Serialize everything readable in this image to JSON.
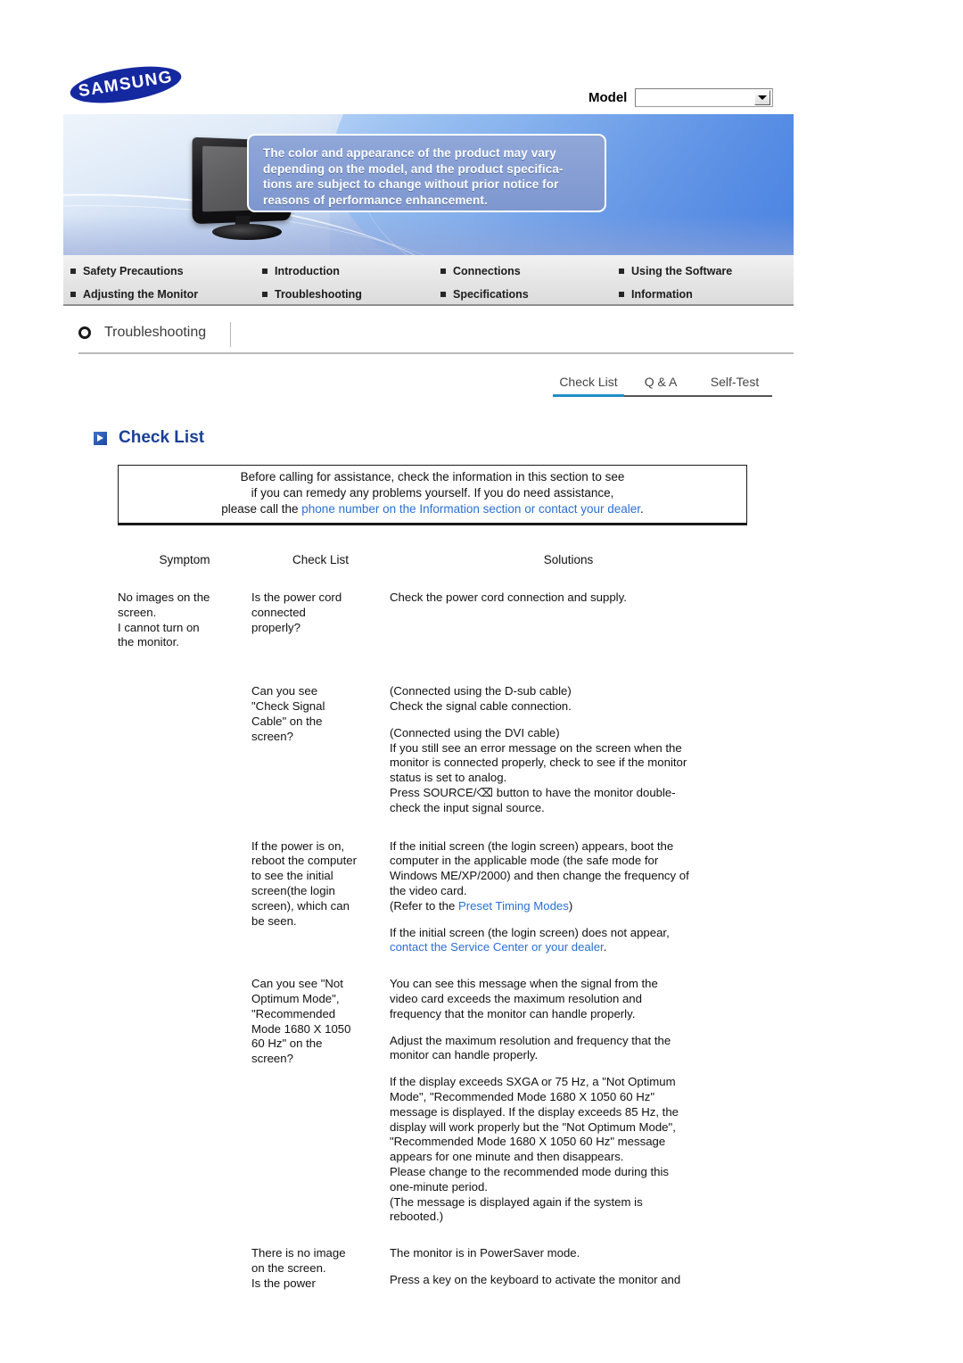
{
  "brand": {
    "logo_text": "SAMSUNG"
  },
  "header": {
    "model_label": "Model",
    "model_value": "",
    "model_dropdown_icon": "chevron-down-icon"
  },
  "banner": {
    "callout_lines": [
      "The color and appearance of the product may vary",
      "depending on the model, and the product specifica-",
      "tions are subject to change without prior notice for",
      "reasons of performance enhancement."
    ],
    "product_image": "monitor-illustration"
  },
  "nav": {
    "items": [
      "Safety Precautions",
      "Introduction",
      "Connections",
      "Using the Software",
      "Adjusting the Monitor",
      "Troubleshooting",
      "Specifications",
      "Information"
    ]
  },
  "section": {
    "icon": "circle-icon",
    "title": "Troubleshooting"
  },
  "tabs": {
    "items": [
      "Check List",
      "Q & A",
      "Self-Test"
    ],
    "active": "Check List",
    "active_color": "#1f8fc7"
  },
  "checklist_heading": {
    "icon": "blue-play-marker-icon",
    "text": "Check List",
    "color": "#1a3f96"
  },
  "intro": {
    "line1": "Before calling for assistance, check the information in this section to see",
    "line2": "if you can remedy any problems yourself. If you do need assistance,",
    "line3_prefix": "please call the ",
    "line3_link": "phone number on the Information section or contact your dealer",
    "line3_suffix": "."
  },
  "table": {
    "headers": [
      "Symptom",
      "Check List",
      "Solutions"
    ],
    "rows": [
      {
        "symptom": "No images on the\nscreen.\nI cannot turn on\nthe monitor.",
        "check": "Is the power cord\nconnected\nproperly?",
        "solution_blocks": [
          {
            "text": "Check the power cord connection and supply."
          }
        ]
      },
      {
        "symptom": "",
        "check": "Can you see\n\"Check Signal\nCable\" on the\nscreen?",
        "solution_blocks": [
          {
            "text": "(Connected using the D-sub cable)\nCheck the signal cable connection."
          },
          {
            "text": "(Connected using the DVI cable)\nIf you still see an error message on the screen when the\nmonitor is connected properly, check to see if the monitor\nstatus is set to analog.\nPress SOURCE/⌫ button to have the monitor double-\ncheck the input signal source."
          }
        ]
      },
      {
        "symptom": "",
        "check": "If the power is on,\nreboot the computer\nto see the initial\nscreen(the login\nscreen), which can\nbe seen.",
        "solution_blocks": [
          {
            "text": "If the initial screen (the login screen) appears, boot the\ncomputer in the applicable mode (the safe mode for\nWindows ME/XP/2000) and then change the frequency of\nthe video card."
          },
          {
            "prefix": "(Refer to the ",
            "link": "Preset Timing Modes",
            "suffix": ")"
          },
          {
            "prefix": "If the initial screen (the login screen) does not appear,\n",
            "link": "contact the Service Center or your dealer",
            "suffix": "."
          }
        ]
      },
      {
        "symptom": "",
        "check": "Can you see \"Not\nOptimum Mode\",\n\"Recommended\nMode 1680 X 1050\n60 Hz\" on the\nscreen?",
        "solution_blocks": [
          {
            "text": "You can see this message when the signal from the\nvideo card exceeds the maximum resolution and\nfrequency that the monitor can handle properly."
          },
          {
            "text": "Adjust the maximum resolution and frequency that the\nmonitor can handle properly."
          },
          {
            "text": "If the display exceeds SXGA or 75 Hz, a \"Not Optimum\nMode\", \"Recommended Mode 1680 X 1050 60 Hz\"\nmessage is displayed. If the display exceeds 85 Hz, the\ndisplay will work properly but the \"Not Optimum Mode\",\n\"Recommended Mode 1680 X 1050 60 Hz\" message\nappears for one minute and then disappears.\nPlease change to the recommended mode during this\none-minute period.\n(The message is displayed again if the system is\nrebooted.)"
          }
        ]
      },
      {
        "symptom": "",
        "check": "There is no image\non the screen.\nIs the power",
        "solution_blocks": [
          {
            "text": "The monitor is in PowerSaver mode."
          },
          {
            "text": "Press a key on the keyboard to activate the monitor and"
          }
        ]
      }
    ]
  }
}
